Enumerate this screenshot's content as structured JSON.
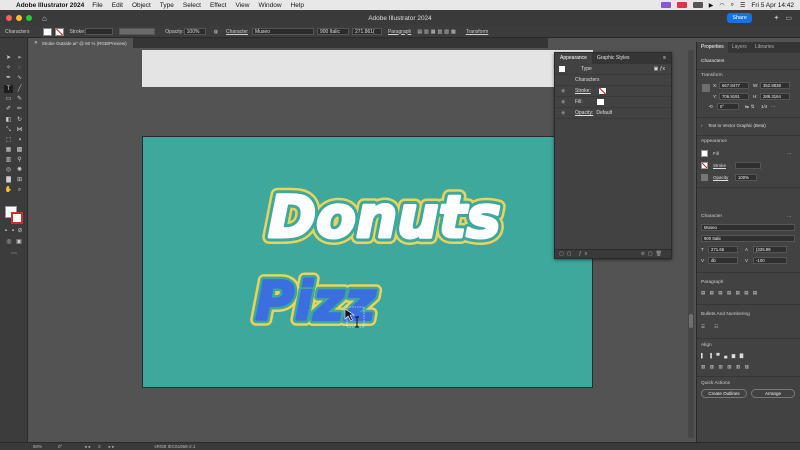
{
  "menubar": {
    "app_name": "Adobe Illustrator 2024",
    "items": [
      "File",
      "Edit",
      "Object",
      "Type",
      "Select",
      "Effect",
      "View",
      "Window",
      "Help"
    ],
    "datetime": "Fri 5 Apr  14:42"
  },
  "titlebar": {
    "title": "Adobe Illustrator 2024",
    "share_label": "Share"
  },
  "controlbar": {
    "context": "Characters",
    "stroke_label": "Stroke:",
    "opacity_label": "Opacity:",
    "opacity_value": "100%",
    "character_label": "Character",
    "font_family": "Museo",
    "font_style": "900 Italic",
    "font_size": "271.861(",
    "paragraph_label": "Paragraph",
    "transform_label": "Transform"
  },
  "document": {
    "tab_title": "Stroke Outside.ai* @ 50 % (RGB/Preview)"
  },
  "appearance_panel": {
    "tabs": [
      "Appearance",
      "Graphic Styles"
    ],
    "type_label": "Type",
    "characters_label": "Characters",
    "stroke_label": "Stroke:",
    "fill_label": "Fill:",
    "opacity_label": "Opacity:",
    "opacity_value": "Default"
  },
  "properties_panel": {
    "tabs": [
      "Properties",
      "Layers",
      "Libraries"
    ],
    "selection_label": "Characters",
    "transform_header": "Transform",
    "x_value": "667.8477",
    "y_value": "706.9191",
    "w_value": "352.8838",
    "h_value": "289.3164",
    "angle_value": "0°",
    "transform_ratio": "1/4",
    "text_to_vector": "Text to Vector Graphic (Beta)",
    "appearance_header": "Appearance",
    "fill_label": "Fill",
    "stroke_label": "Stroke",
    "opacity_label": "Opacity",
    "opacity_value": "100%",
    "character_header": "Character",
    "font_family": "Museo",
    "font_style": "900 Italic",
    "font_size": "271.66",
    "leading": "(325.99",
    "kerning": "db",
    "tracking": "-100",
    "paragraph_header": "Paragraph",
    "bullets_header": "Bullets And Numbering",
    "align_header": "Align",
    "quick_actions_header": "Quick Actions",
    "create_outlines_label": "Create Outlines",
    "arrange_label": "Arrange"
  },
  "canvas": {
    "donuts_text": "Donuts",
    "pizza_text": "Pizz"
  },
  "statusbar": {
    "zoom": "50%",
    "rotation": "0°",
    "artboard_num": "2",
    "color_profile": "sRGB IEC61966-2.1"
  },
  "colors": {
    "artboard": "#3ea89c",
    "stroke_yellow": "#e8d45c",
    "pizza_fill": "#3b6fe0"
  }
}
